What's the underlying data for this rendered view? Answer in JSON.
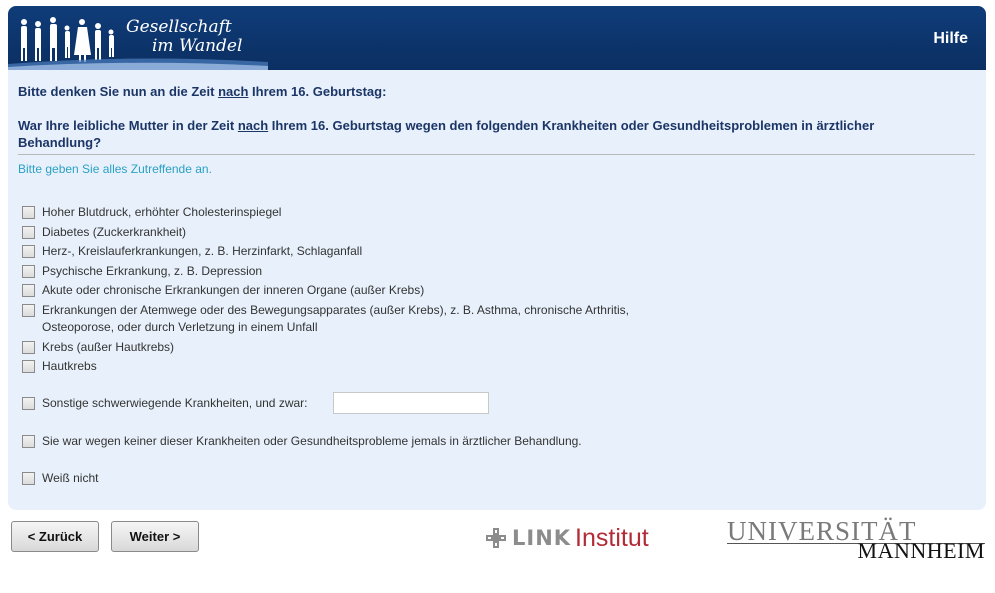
{
  "header": {
    "title_line1": "Gesellschaft",
    "title_line2": "im Wandel",
    "help_label": "Hilfe",
    "logo_icon": "people-silhouettes-icon"
  },
  "question": {
    "intro_prefix": "Bitte denken Sie nun an die Zeit ",
    "intro_emph": "nach",
    "intro_suffix": " Ihrem 16. Geburtstag:",
    "text_prefix": "War Ihre leibliche Mutter in der Zeit ",
    "text_emph": "nach",
    "text_suffix": " Ihrem 16. Geburtstag wegen den folgenden Krankheiten oder Gesundheitsproblemen in ärztlicher Behandlung?",
    "instruction": "Bitte geben Sie alles Zutreffende an."
  },
  "options": [
    "Hoher Blutdruck, erhöhter Cholesterinspiegel",
    "Diabetes (Zuckerkrankheit)",
    "Herz-, Kreislauferkrankungen, z. B. Herzinfarkt, Schlaganfall",
    "Psychische Erkrankung, z. B. Depression",
    "Akute oder chronische Erkrankungen der inneren Organe (außer Krebs)",
    "Erkrankungen der Atemwege oder des Bewegungsapparates (außer Krebs), z. B. Asthma, chronische Arthritis, Osteoporose, oder durch Verletzung in einem Unfall",
    "Krebs (außer Hautkrebs)",
    "Hautkrebs",
    "Sonstige schwerwiegende Krankheiten, und zwar:",
    "Sie war wegen keiner dieser Krankheiten oder Gesundheitsprobleme jemals in ärztlicher Behandlung.",
    "Weiß nicht"
  ],
  "other_input_value": "",
  "nav": {
    "back_label": "< Zurück",
    "next_label": "Weiter >"
  },
  "logos": {
    "link_word": "LINK",
    "institut_word": "Institut",
    "uni_line1": "UNIVERSITÄT",
    "uni_line2": "MANNHEIM"
  },
  "colors": {
    "header_bg": "#0f3c79",
    "panel_bg": "#e8f1fb",
    "question_text": "#1c3567",
    "instruction_text": "#2aa0c4",
    "link_red": "#b22b36"
  }
}
